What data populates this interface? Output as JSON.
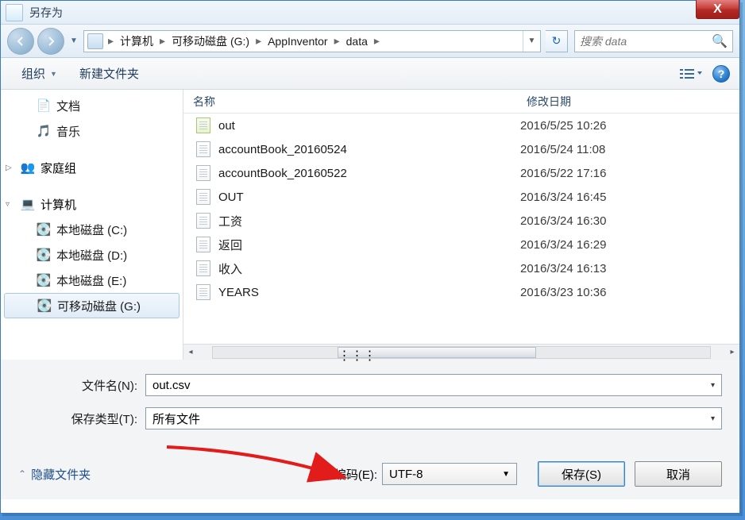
{
  "window": {
    "title": "另存为"
  },
  "nav": {
    "breadcrumb": [
      "计算机",
      "可移动磁盘 (G:)",
      "AppInventor",
      "data"
    ],
    "search_placeholder": "搜索 data"
  },
  "toolbar": {
    "organize": "组织",
    "new_folder": "新建文件夹"
  },
  "sidebar": {
    "documents": "文档",
    "music": "音乐",
    "homegroup": "家庭组",
    "computer": "计算机",
    "drives": [
      "本地磁盘 (C:)",
      "本地磁盘 (D:)",
      "本地磁盘 (E:)",
      "可移动磁盘 (G:)"
    ]
  },
  "columns": {
    "name": "名称",
    "modified": "修改日期"
  },
  "files": [
    {
      "name": "out",
      "date": "2016/5/25 10:26",
      "kind": "script"
    },
    {
      "name": "accountBook_20160524",
      "date": "2016/5/24 11:08",
      "kind": "doc"
    },
    {
      "name": "accountBook_20160522",
      "date": "2016/5/22 17:16",
      "kind": "doc"
    },
    {
      "name": "OUT",
      "date": "2016/3/24 16:45",
      "kind": "doc"
    },
    {
      "name": "工资",
      "date": "2016/3/24 16:30",
      "kind": "doc"
    },
    {
      "name": "返回",
      "date": "2016/3/24 16:29",
      "kind": "doc"
    },
    {
      "name": "收入",
      "date": "2016/3/24 16:13",
      "kind": "doc"
    },
    {
      "name": "YEARS",
      "date": "2016/3/23 10:36",
      "kind": "doc"
    }
  ],
  "form": {
    "filename_label": "文件名(N):",
    "filename_value": "out.csv",
    "type_label": "保存类型(T):",
    "type_value": "所有文件"
  },
  "footer": {
    "hide_folders": "隐藏文件夹",
    "encoding_label": "编码(E):",
    "encoding_value": "UTF-8",
    "save": "保存(S)",
    "cancel": "取消"
  }
}
